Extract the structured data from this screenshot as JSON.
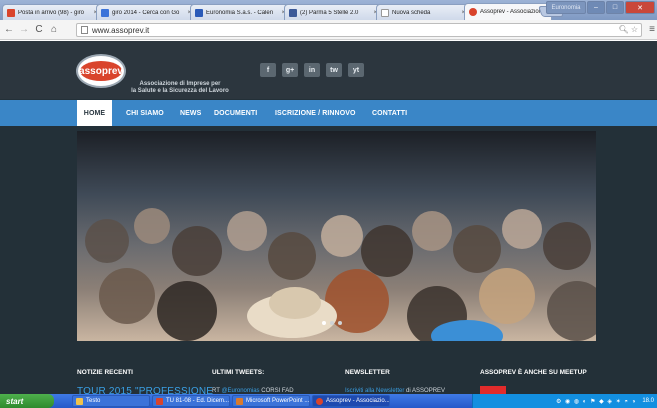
{
  "browser": {
    "tabs": [
      {
        "title": "Posta in arrivo (98) - giro",
        "color": "#d9442c"
      },
      {
        "title": "giro 2014 - Cerca con Go",
        "color": "#3b73d9"
      },
      {
        "title": "Euronomia S.a.s. - Calen",
        "color": "#2a5ab8"
      },
      {
        "title": "(2) Parma 5 Stelle 2.0",
        "color": "#3b5998"
      },
      {
        "title": "Nuova scheda",
        "color": "#ffffff"
      },
      {
        "title": "Assoprev - Associazione",
        "color": "#d9442c"
      }
    ],
    "close_glyph": "×",
    "url": "www.assoprev.it",
    "window_user": "Euronomia"
  },
  "site": {
    "logo_text": "assoprev",
    "tagline_line1": "Associazione di Imprese per",
    "tagline_line2": "la Salute e la Sicurezza del Lavoro",
    "social": [
      "f",
      "g+",
      "in",
      "tw",
      "yt"
    ],
    "nav": [
      "HOME",
      "CHI SIAMO",
      "NEWS",
      "DOCUMENTI",
      "ISCRIZIONE / RINNOVO",
      "CONTATTI"
    ],
    "active_nav": "HOME",
    "slider_dots": 3,
    "footer": {
      "col1_title": "NOTIZIE RECENTI",
      "col1_item": "TOUR 2015 \"PROFESSIONE",
      "col2_title": "ULTIMI TWEETS:",
      "col2_rt": "RT",
      "col2_handle": "@Euronomias",
      "col2_text": "CORSI FAD",
      "col3_title": "NEWSLETTER",
      "col3_link": "Iscriviti alla Newsletter",
      "col3_text": "di ASSOPREV",
      "col4_title": "ASSOPREV È ANCHE SU MEETUP"
    }
  },
  "taskbar": {
    "start_label": "start",
    "items": [
      {
        "label": "Testo",
        "active": false,
        "color": "#f0c24a"
      },
      {
        "label": "TU 81-08 - Ed. Dicem...",
        "active": false,
        "color": "#d9442c"
      },
      {
        "label": "Microsoft PowerPoint ...",
        "active": false,
        "color": "#d97a2c"
      },
      {
        "label": "Assoprev - Associazio...",
        "active": true,
        "color": "#d9442c"
      }
    ],
    "clock": "18.0"
  }
}
